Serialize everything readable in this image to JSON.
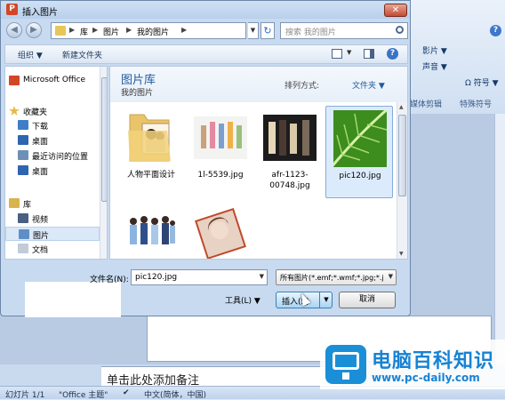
{
  "dialog": {
    "title": "插入图片",
    "app_icon_text": "P",
    "close_label": "✕",
    "nav": {
      "back_glyph": "◀",
      "forward_glyph": "▶",
      "breadcrumbs": [
        "库",
        "图片",
        "我的图片"
      ],
      "refresh_glyph": "↻",
      "search_placeholder": "搜索 我的图片"
    },
    "toolbar": {
      "organize_label": "组织 ▼",
      "new_folder_label": "新建文件夹",
      "help_label": "?"
    },
    "navpane": {
      "items": [
        {
          "label": "Microsoft Office",
          "level": "top",
          "icon": "office-icon",
          "color": "#d24726"
        },
        {
          "label": "收藏夹",
          "level": "top",
          "icon": "star-icon",
          "color": "#e8b84a"
        },
        {
          "label": "下载",
          "level": "sub",
          "icon": "download-icon",
          "color": "#3f7ec7"
        },
        {
          "label": "桌面",
          "level": "sub",
          "icon": "desktop-icon",
          "color": "#2e64b0"
        },
        {
          "label": "最近访问的位置",
          "level": "sub",
          "icon": "recent-icon",
          "color": "#6f8fb6"
        },
        {
          "label": "桌面",
          "level": "sub",
          "icon": "desktop-icon",
          "color": "#2e64b0"
        },
        {
          "label": "库",
          "level": "top",
          "icon": "library-icon",
          "color": "#d9b34e"
        },
        {
          "label": "视频",
          "level": "sub",
          "icon": "video-icon",
          "color": "#4a5f82"
        },
        {
          "label": "图片",
          "level": "sub",
          "icon": "picture-icon",
          "color": "#5f8fc6",
          "selected": true
        },
        {
          "label": "文档",
          "level": "sub",
          "icon": "document-icon",
          "color": "#c2cbd8"
        }
      ]
    },
    "library": {
      "title": "图片库",
      "subtitle": "我的图片",
      "sort_label": "排列方式:",
      "sort_value": "文件夹 ▼"
    },
    "files": [
      {
        "label": "人物平面设计",
        "kind": "folder"
      },
      {
        "label": "1l-5539.jpg",
        "kind": "image"
      },
      {
        "label": "afr-1123-00748.jpg",
        "kind": "image"
      },
      {
        "label": "pic120.jpg",
        "kind": "image",
        "selected": true
      },
      {
        "label": "",
        "kind": "image"
      },
      {
        "label": "",
        "kind": "image"
      }
    ],
    "bottom": {
      "filename_label": "文件名(N):",
      "filename_value": "pic120.jpg",
      "filetype_value": "所有图片(*.emf;*.wmf;*.jpg;*.j",
      "tools_label": "工具(L)  ▼",
      "insert_label": "插入(S)",
      "cancel_label": "取消"
    }
  },
  "background": {
    "ribbon": {
      "film_label": "影片 ▼",
      "sound_label": "声音 ▼",
      "symbol_label": "Ω 符号 ▼",
      "group_media": "媒体剪辑",
      "group_symbols": "特殊符号"
    },
    "notes_placeholder": "单击此处添加备注",
    "status": {
      "slide": "幻灯片 1/1",
      "theme": "\"Office 主题\"",
      "language": "中文(简体，中国)"
    },
    "watermark": {
      "title": "电脑百科知识",
      "url": "www.pc-daily.com"
    }
  }
}
